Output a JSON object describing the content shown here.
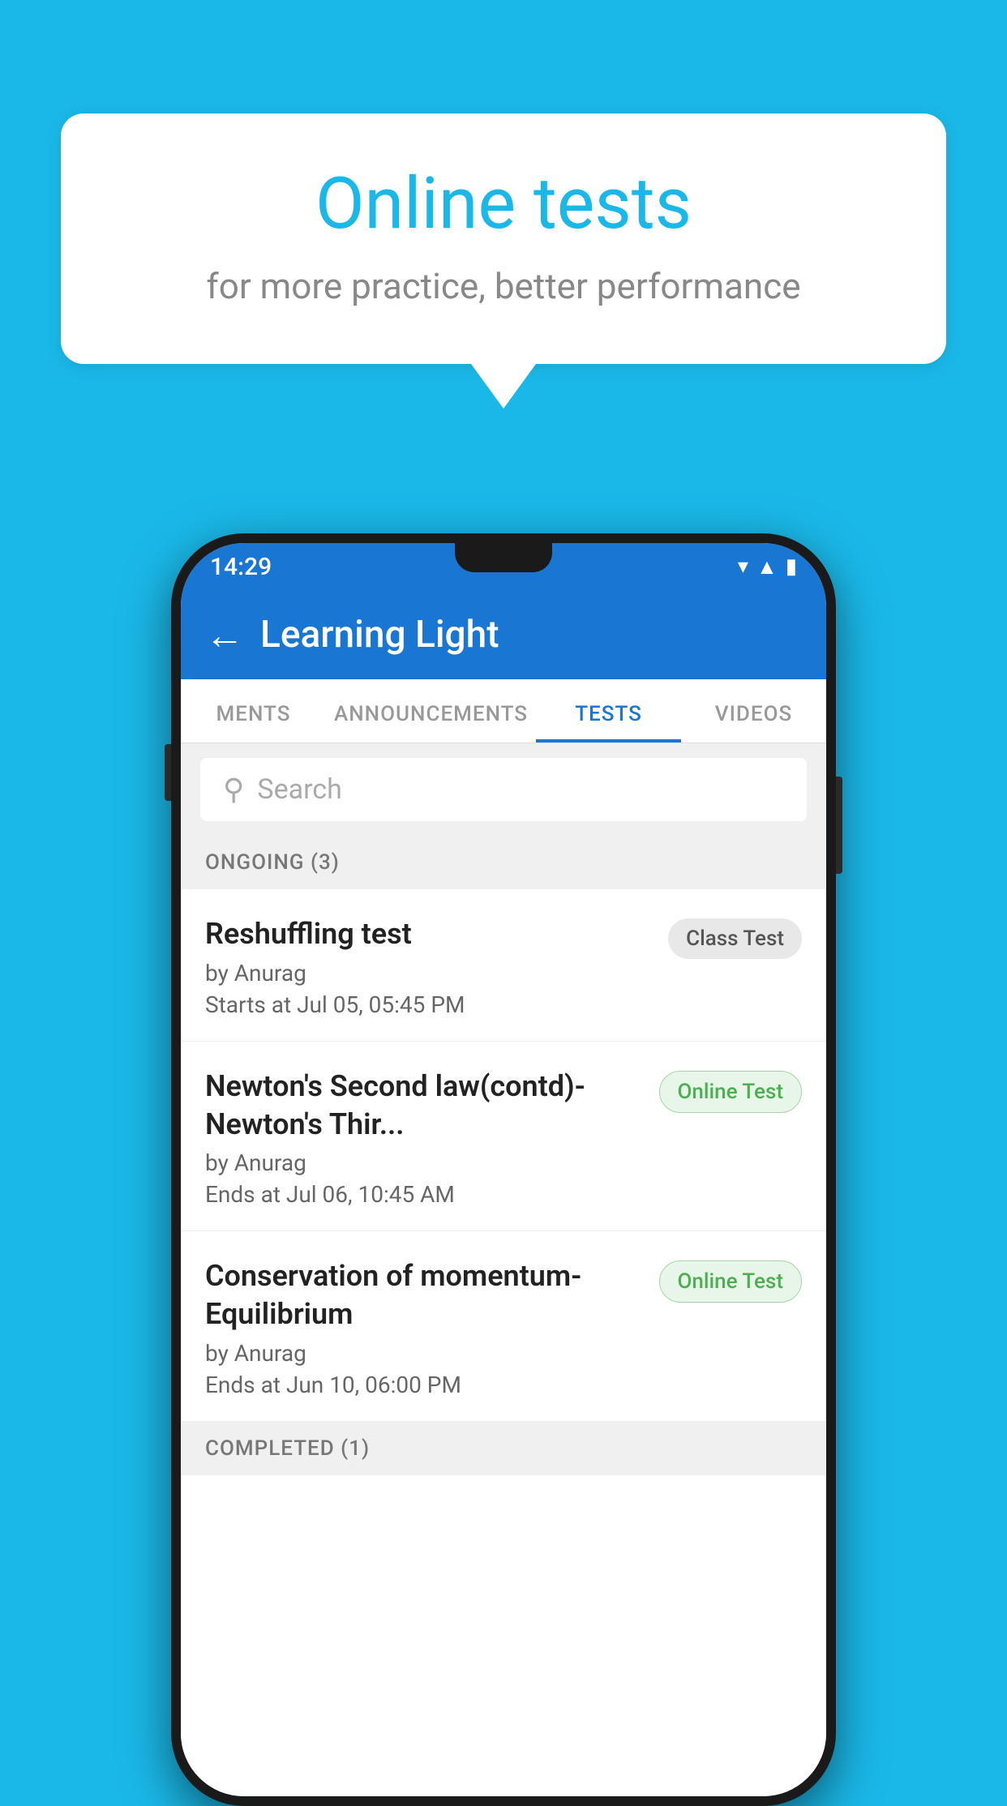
{
  "background": {
    "color": "#1ab8e8"
  },
  "speech_bubble": {
    "title": "Online tests",
    "subtitle": "for more practice, better performance"
  },
  "phone": {
    "status_bar": {
      "time": "14:29",
      "icons": [
        "wifi",
        "signal",
        "battery"
      ]
    },
    "app_bar": {
      "title": "Learning Light",
      "back_label": "←"
    },
    "tabs": [
      {
        "label": "MENTS",
        "active": false
      },
      {
        "label": "ANNOUNCEMENTS",
        "active": false
      },
      {
        "label": "TESTS",
        "active": true
      },
      {
        "label": "VIDEOS",
        "active": false
      }
    ],
    "search": {
      "placeholder": "Search"
    },
    "sections": [
      {
        "id": "ongoing",
        "label": "ONGOING (3)",
        "tests": [
          {
            "title": "Reshuffling test",
            "author": "by Anurag",
            "date": "Starts at  Jul 05, 05:45 PM",
            "badge": "Class Test",
            "badge_type": "class"
          },
          {
            "title": "Newton's Second law(contd)-Newton's Thir...",
            "author": "by Anurag",
            "date": "Ends at  Jul 06, 10:45 AM",
            "badge": "Online Test",
            "badge_type": "online"
          },
          {
            "title": "Conservation of momentum-Equilibrium",
            "author": "by Anurag",
            "date": "Ends at  Jun 10, 06:00 PM",
            "badge": "Online Test",
            "badge_type": "online"
          }
        ]
      },
      {
        "id": "completed",
        "label": "COMPLETED (1)",
        "tests": []
      }
    ]
  }
}
